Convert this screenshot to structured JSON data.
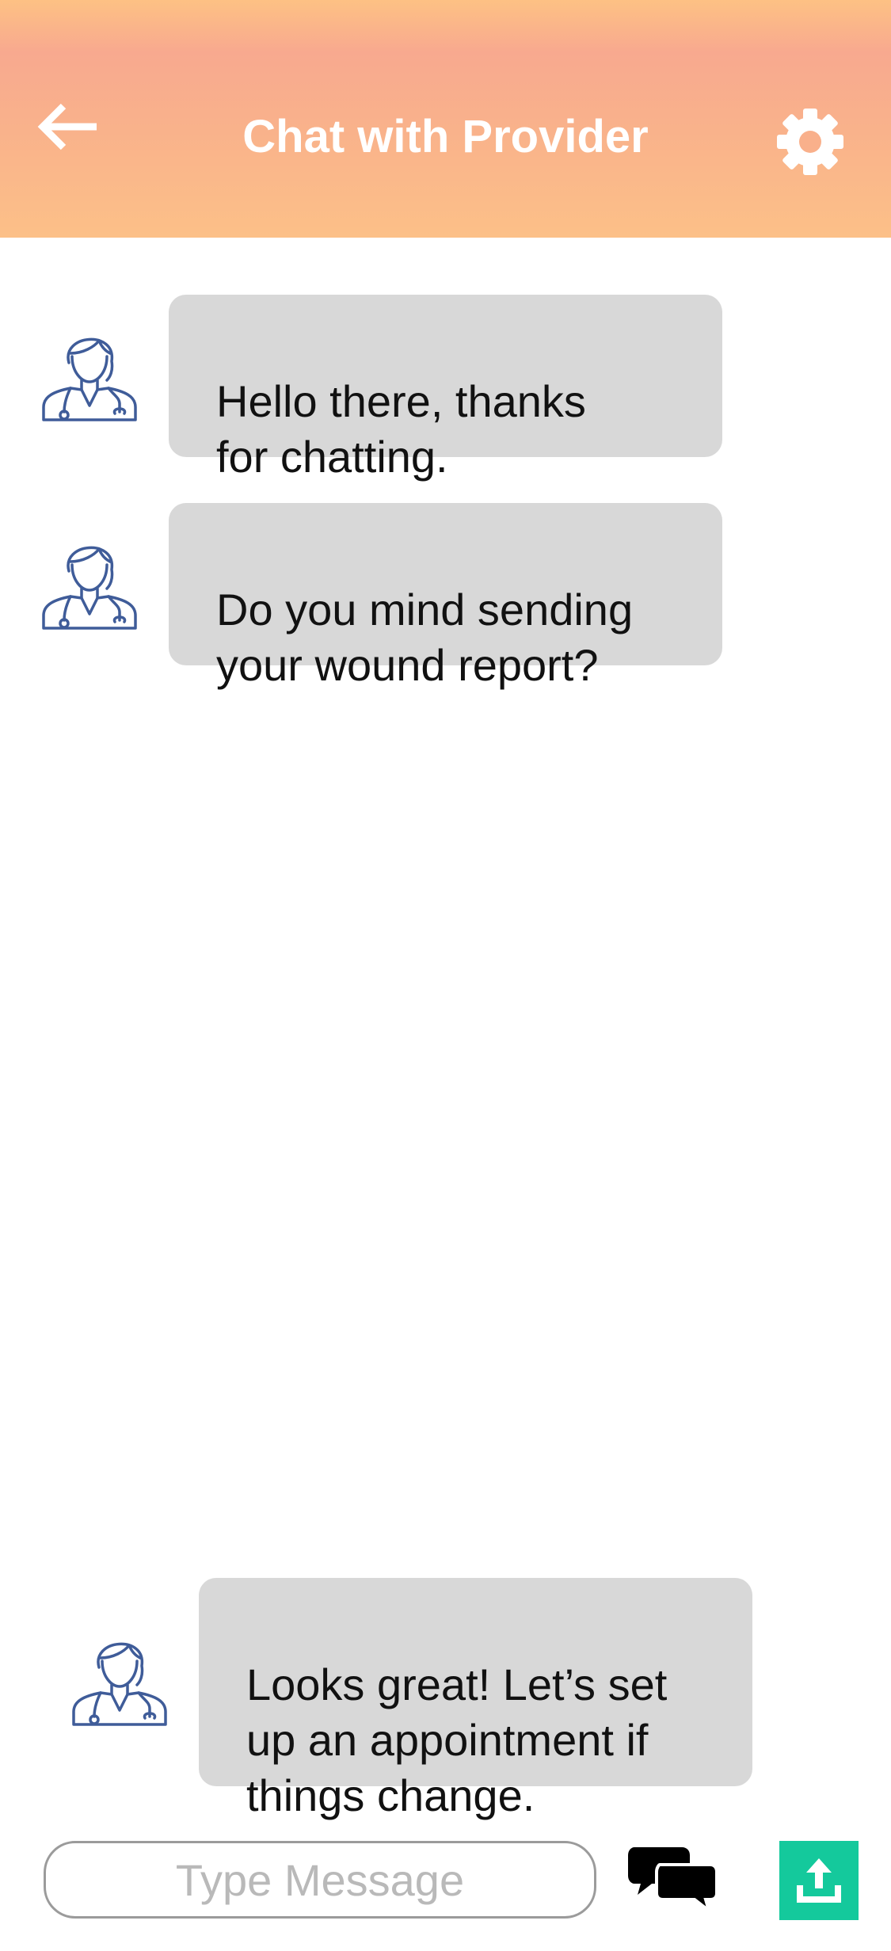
{
  "header": {
    "title": "Chat with Provider",
    "back_icon": "arrow-left-icon",
    "settings_icon": "gear-icon",
    "gradient_colors": [
      "#fdc184",
      "#f8a98f",
      "#fcc088"
    ]
  },
  "messages": [
    {
      "sender": "provider",
      "avatar_icon": "doctor-avatar-icon",
      "text": "Hello there, thanks\nfor chatting."
    },
    {
      "sender": "provider",
      "avatar_icon": "doctor-avatar-icon",
      "text": "Do you mind sending\nyour wound report?"
    },
    {
      "sender": "provider",
      "avatar_icon": "doctor-avatar-icon",
      "text": "Looks great! Let’s set\nup an appointment if\nthings change."
    }
  ],
  "composer": {
    "placeholder": "Type Message",
    "chat_icon": "chat-bubbles-icon",
    "upload_icon": "upload-icon",
    "upload_color": "#14c99c"
  },
  "colors": {
    "bubble": "#d8d8d8",
    "avatar_stroke": "#3f5c99"
  }
}
